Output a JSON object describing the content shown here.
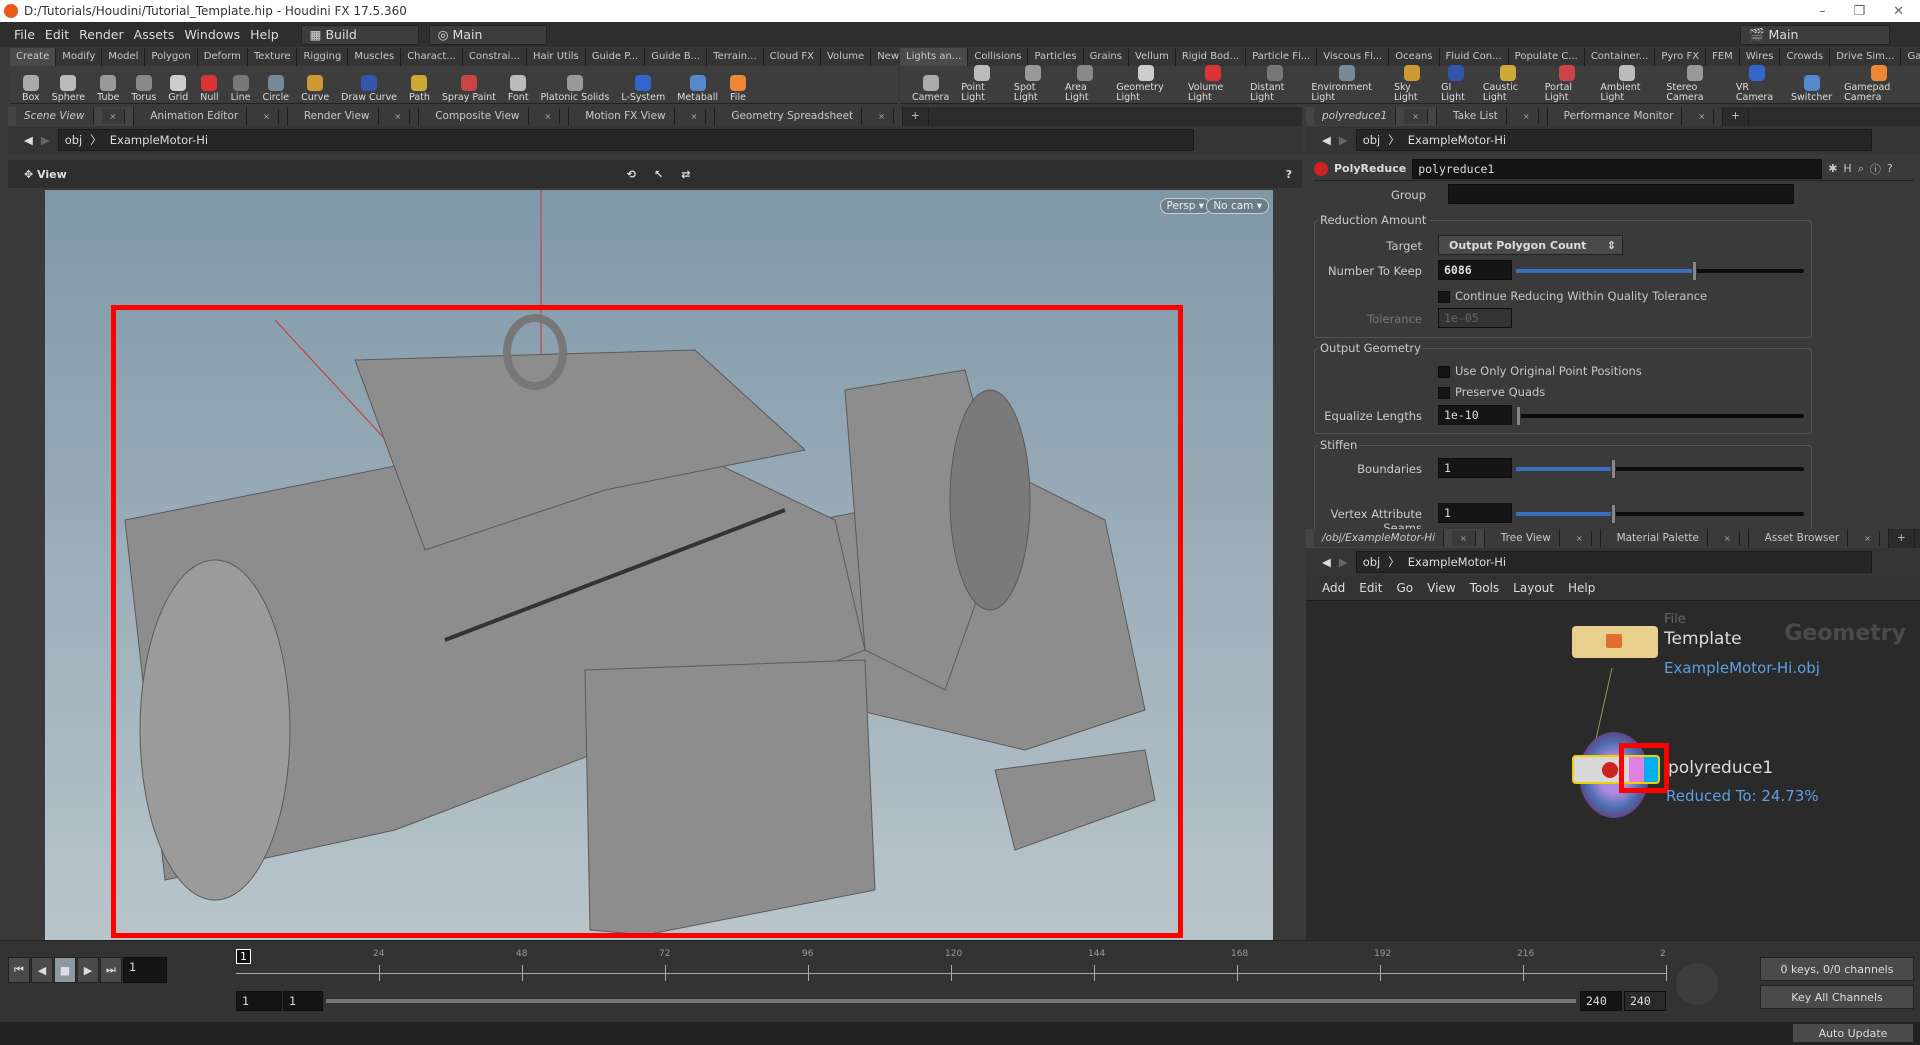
{
  "window": {
    "title": "D:/Tutorials/Houdini/Tutorial_Template.hip - Houdini FX 17.5.360"
  },
  "menu": [
    "File",
    "Edit",
    "Render",
    "Assets",
    "Windows",
    "Help"
  ],
  "desktop": "Build",
  "context_left": "Main",
  "context_right": "Main",
  "shelf_left": {
    "tabs": [
      "Create",
      "Modify",
      "Model",
      "Polygon",
      "Deform",
      "Texture",
      "Rigging",
      "Muscles",
      "Charact...",
      "Constrai...",
      "Hair Utils",
      "Guide P...",
      "Guide B...",
      "Terrain...",
      "Cloud FX",
      "Volume",
      "New Shelf"
    ],
    "tools": [
      "Box",
      "Sphere",
      "Tube",
      "Torus",
      "Grid",
      "Null",
      "Line",
      "Circle",
      "Curve",
      "Draw Curve",
      "Path",
      "Spray Paint",
      "Font",
      "Platonic Solids",
      "L-System",
      "Metaball",
      "File"
    ]
  },
  "shelf_right": {
    "tabs": [
      "Lights an...",
      "Collisions",
      "Particles",
      "Grains",
      "Vellum",
      "Rigid Bod...",
      "Particle Fl...",
      "Viscous Fl...",
      "Oceans",
      "Fluid Con...",
      "Populate C...",
      "Container...",
      "Pyro FX",
      "FEM",
      "Wires",
      "Crowds",
      "Drive Sim...",
      "Game Devel..."
    ],
    "tools": [
      "Camera",
      "Point Light",
      "Spot Light",
      "Area Light",
      "Geometry Light",
      "Volume Light",
      "Distant Light",
      "Environment Light",
      "Sky Light",
      "GI Light",
      "Caustic Light",
      "Portal Light",
      "Ambient Light",
      "Stereo Camera",
      "VR Camera",
      "Switcher",
      "Gamepad Camera"
    ]
  },
  "scene": {
    "tabs": [
      "Scene View",
      "Animation Editor",
      "Render View",
      "Composite View",
      "Motion FX View",
      "Geometry Spreadsheet"
    ],
    "path": [
      "obj",
      "ExampleMotor-Hi"
    ],
    "view_label": "View",
    "persp": "Persp",
    "cam": "No cam"
  },
  "params": {
    "tabs": [
      "polyreduce1",
      "Take List",
      "Performance Monitor"
    ],
    "path": [
      "obj",
      "ExampleMotor-Hi"
    ],
    "node_type": "PolyReduce",
    "node_name": "polyreduce1",
    "group_label": "Group",
    "group_value": "",
    "reduction_title": "Reduction Amount",
    "target_label": "Target",
    "target_value": "Output Polygon Count",
    "keep_label": "Number To Keep",
    "keep_value": "6086",
    "keep_fraction": 0.61,
    "continue_label": "Continue Reducing Within Quality Tolerance",
    "continue_checked": false,
    "tolerance_label": "Tolerance",
    "tolerance_value": "1e-05",
    "output_title": "Output Geometry",
    "orig_label": "Use Only Original Point Positions",
    "quads_label": "Preserve Quads",
    "equalize_label": "Equalize Lengths",
    "equalize_value": "1e-10",
    "stiffen_title": "Stiffen",
    "boundaries_label": "Boundaries",
    "boundaries_value": "1",
    "vas_label": "Vertex Attribute Seams",
    "vas_value": "1",
    "stiffen_fraction": 0.33
  },
  "network": {
    "tabs": [
      "/obj/ExampleMotor-Hi",
      "Tree View",
      "Material Palette",
      "Asset Browser"
    ],
    "path": [
      "obj",
      "ExampleMotor-Hi"
    ],
    "menu": [
      "Add",
      "Edit",
      "Go",
      "View",
      "Tools",
      "Layout",
      "Help"
    ],
    "context_watermark": "Geometry",
    "file_node": {
      "type": "File",
      "name": "Template",
      "info": "ExampleMotor-Hi.obj"
    },
    "reduce_node": {
      "name": "polyreduce1",
      "info": "Reduced To: 24.73%"
    }
  },
  "timeline": {
    "frame": "1",
    "ticks": [
      "24",
      "48",
      "72",
      "96",
      "120",
      "144",
      "168",
      "192",
      "216",
      "2"
    ],
    "start": "1",
    "start2": "1",
    "end": "240",
    "end2": "240",
    "keys": "0 keys, 0/0 channels",
    "key_mode": "Key All Channels"
  },
  "status": {
    "update_mode": "Auto Update"
  },
  "colors": {
    "highlight": "#ff0000",
    "link": "#5aa0e6",
    "slider": "#3a6fc0"
  }
}
